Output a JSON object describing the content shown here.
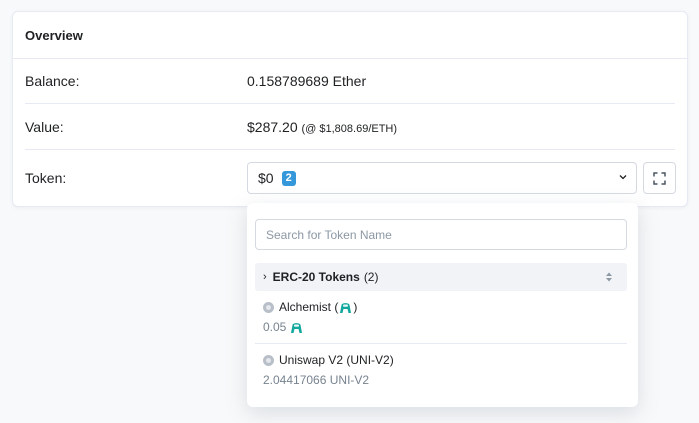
{
  "card": {
    "title": "Overview"
  },
  "rows": {
    "balance": {
      "label": "Balance:",
      "value": "0.158789689 Ether"
    },
    "value": {
      "label": "Value:",
      "value": "$287.20",
      "rate": "(@ $1,808.69/ETH)"
    },
    "token": {
      "label": "Token:",
      "selected": "$0",
      "badge": "2"
    }
  },
  "dropdown": {
    "search_placeholder": "Search for Token Name",
    "group": {
      "name": "ERC-20 Tokens",
      "count": "(2)"
    },
    "items": [
      {
        "name_prefix": "Alchemist (",
        "name_suffix": ")",
        "balance": "0.05",
        "icon": "alchemist-token-icon"
      },
      {
        "name": "Uniswap V2 (UNI-V2)",
        "balance": "2.04417066 UNI-V2",
        "icon": "coin-icon"
      }
    ]
  },
  "colors": {
    "badge": "#3498db",
    "accent_icon": "#13a89e"
  }
}
